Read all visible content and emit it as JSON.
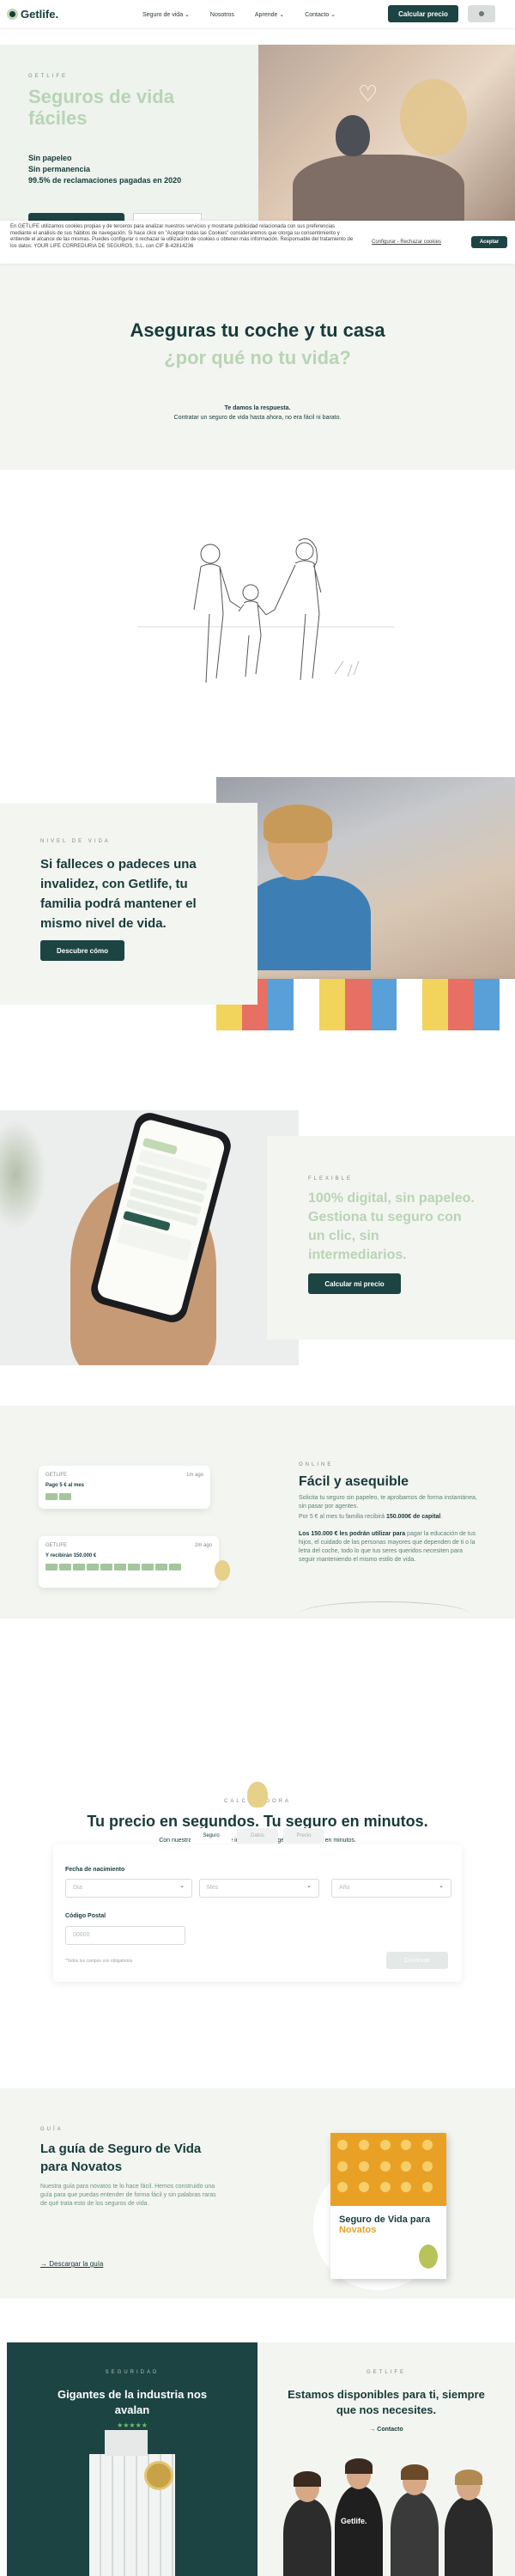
{
  "header": {
    "logo": "Getlife.",
    "nav": [
      "Seguro de vida ⌄",
      "Nosotros",
      "Aprende ⌄",
      "Contacto ⌄"
    ],
    "cta": "Calcular precio"
  },
  "hero": {
    "eyebrow": "GETLIFE",
    "title": "Seguros de vida fáciles",
    "points": [
      "Sin papeleo",
      "Sin permanencia",
      "99.5% de reclamaciones pagadas en 2020"
    ]
  },
  "cookie": {
    "text": "En GETLIFE utilizamos cookies propias y de terceros para analizar nuestros servicios y mostrarte publicidad relacionada con sus preferencias mediante el análisis de sus hábitos de navegación. Si hace click en \"Aceptar todas las Cookies\" consideraremos que otorga su consentimiento y entiende el alcance de las mismas. Puedes configurar o rechazar la utilización de cookies u obtener más información. Responsable del tratamiento de los datos: YOUR LIFE CORREDURIA DE SEGUROS, S.L. con CIF B-42814236",
    "config": "Configurar - Rechazar cookies",
    "accept": "Aceptar"
  },
  "s2": {
    "title": "Aseguras tu coche y tu casa",
    "subtitle": "¿por qué no tu vida?",
    "line1": "Te damos la respuesta.",
    "line2": "Contratar un seguro de vida hasta ahora, no era fácil ni barato."
  },
  "nivel": {
    "eyebrow": "NIVEL DE VIDA",
    "title": "Si falleces o padeces una invalidez, con Getlife, tu familia podrá mantener el mismo nivel de vida.",
    "button": "Descubre cómo"
  },
  "flexible": {
    "eyebrow": "FLEXIBLE",
    "title": "100% digital, sin papeleo. Gestiona tu seguro con un clic, sin intermediarios.",
    "button": "Calcular mi precio"
  },
  "online": {
    "card1": {
      "label": "GETLIFE",
      "ago": "1m ago",
      "value": "Pago 5 € al mes"
    },
    "card2": {
      "label": "GETLIFE",
      "ago": "2m ago",
      "value": "Y recibirán 150.000 €"
    },
    "eyebrow": "ONLINE",
    "title": "Fácil y asequible",
    "p1": "Solicita tu seguro sin papeleo, te aprobamos de forma instantánea, sin pasar por agentes.",
    "p2": "Por 5 € al mes tu familia recibirá 150.000€ de capital.",
    "p3": "Los 150.000 € les podrán utilizar para pagar la educación de tus hijos, el cuidado de las personas mayores que dependen de ti o la letra del coche, todo lo que tus seres queridos necesiten para seguir manteniendo el mismo estilo de vida."
  },
  "calc": {
    "eyebrow": "CALCULADORA",
    "title": "Tu precio en segundos. Tu seguro en minutos.",
    "subtitle": "Con nuestra solicitud online inmediata, protegerás a tu familia en minutos.",
    "tabs": [
      "Seguro",
      "Datos",
      "Precio"
    ],
    "dob_label": "Fecha de nacimiento",
    "day": "Día",
    "month": "Mes",
    "year": "Año",
    "cp_label": "Código Postal",
    "cp_placeholder": "00000",
    "note": "*Todos los campos son obligatorios",
    "button": "Continuar"
  },
  "guide": {
    "eyebrow": "GUÍA",
    "title": "La guía de Seguro de Vida para Novatos",
    "text": "Nuestra guía para novatos te lo hace fácil. Hemos construido una guía para que puedas entender de forma fácil y sin palabras raras de qué trata esto de los seguros de vida.",
    "download": "Descargar la guía",
    "book_title_1": "Seguro de Vida para",
    "book_title_2": "Novatos"
  },
  "bottom": {
    "left_eyebrow": "SEGURIDAD",
    "left_title": "Gigantes de la industria nos avalan",
    "stars": "★★★★★",
    "right_eyebrow": "GETLIFE",
    "right_title": "Estamos disponibles para ti, siempre que nos necesites.",
    "link": "→ Contacto",
    "shirt": "Getlife."
  },
  "colors": {
    "primary": "#1c4443",
    "accent_green": "#b8d4b4",
    "section_bg": "#f3f5f1",
    "orange": "#e9a125"
  }
}
